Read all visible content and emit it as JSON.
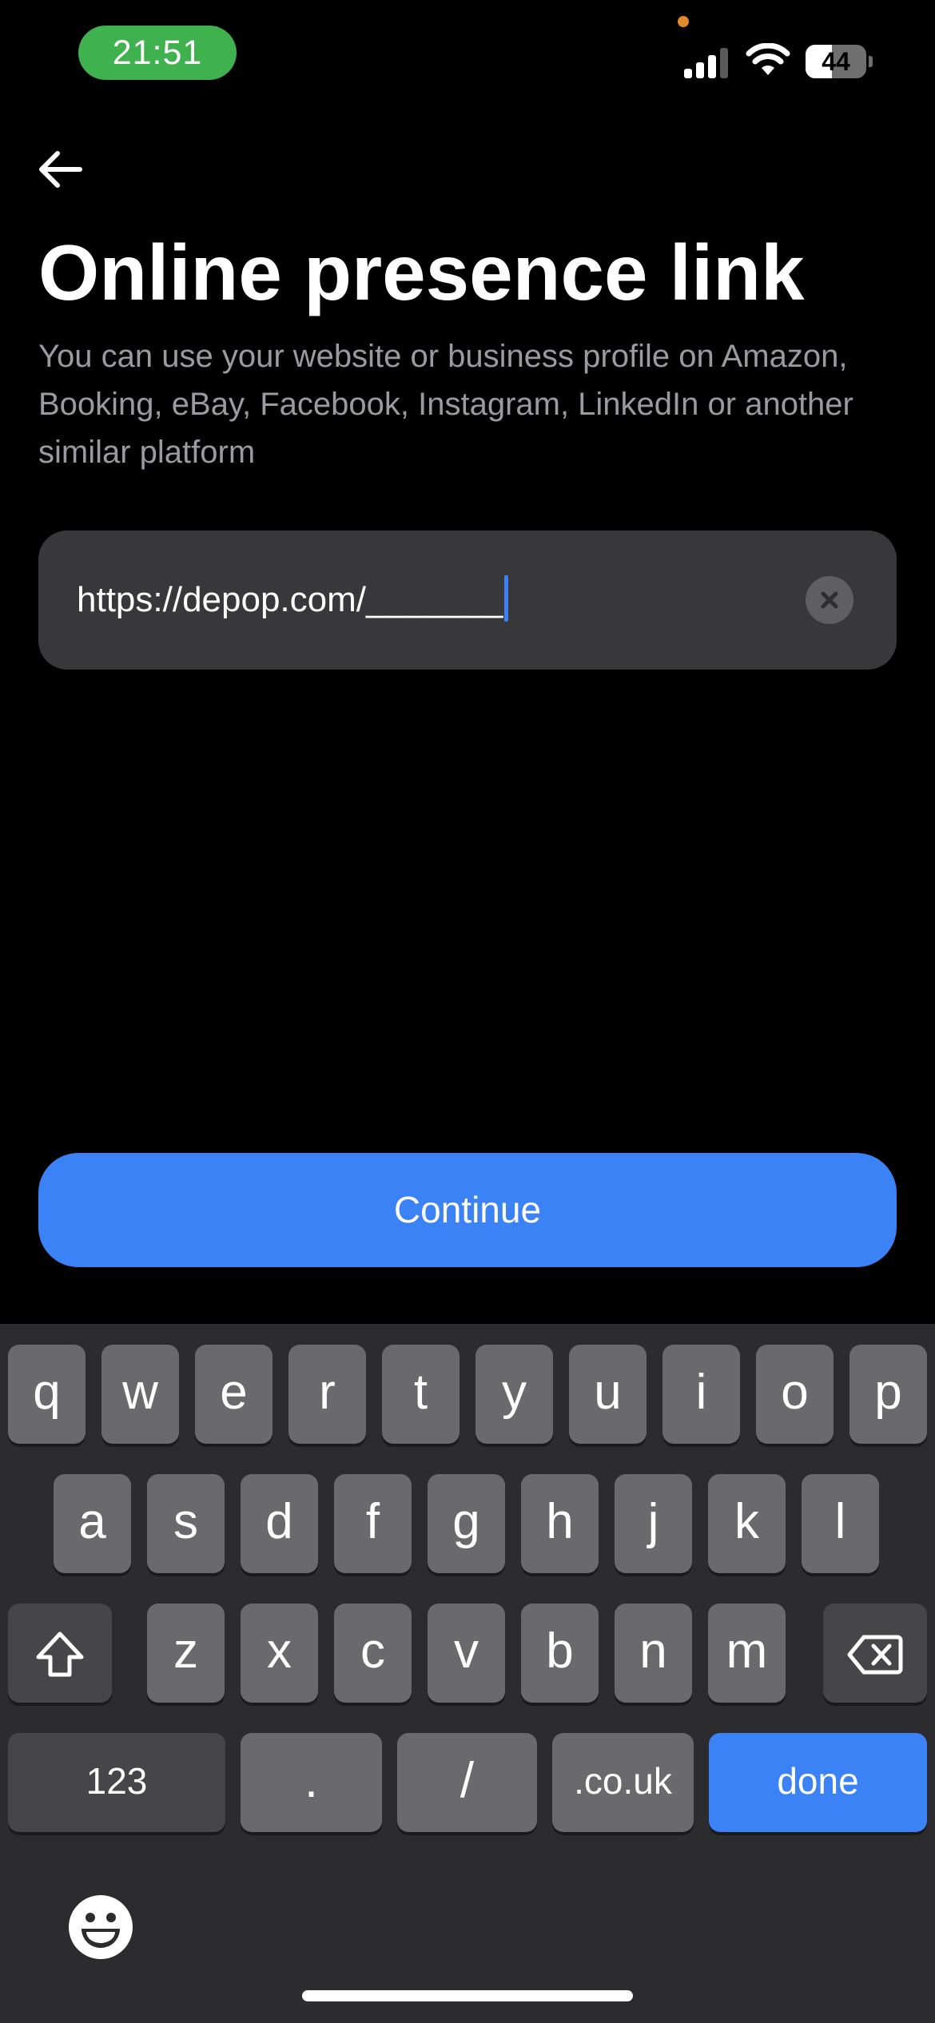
{
  "status_bar": {
    "time": "21:51",
    "battery_level": "44",
    "battery_fraction": 0.44
  },
  "header": {
    "back_icon": "arrow-left-icon",
    "title": "Online presence link",
    "description": "You can use your website or business profile on Amazon, Booking, eBay, Facebook, Instagram, LinkedIn or another similar platform"
  },
  "url_input": {
    "value": "https://depop.com/_______",
    "clear_icon": "close-icon"
  },
  "continue_button": {
    "label": "Continue"
  },
  "keyboard": {
    "row1": [
      "q",
      "w",
      "e",
      "r",
      "t",
      "y",
      "u",
      "i",
      "o",
      "p"
    ],
    "row2": [
      "a",
      "s",
      "d",
      "f",
      "g",
      "h",
      "j",
      "k",
      "l"
    ],
    "row3": [
      "z",
      "x",
      "c",
      "v",
      "b",
      "n",
      "m"
    ],
    "row4": {
      "numbers": "123",
      "dot": ".",
      "slash": "/",
      "domain": ".co.uk",
      "done": "done"
    },
    "shift_icon": "shift-icon",
    "backspace_icon": "backspace-icon",
    "emoji_icon": "emoji-icon"
  },
  "colors": {
    "accent": "#3a82f6",
    "background": "#000000",
    "field_background": "#38383b",
    "keyboard_background": "#2c2c2e",
    "key": "#6a6a6d",
    "function_key": "#464648",
    "time_pill": "#3fb24f"
  }
}
